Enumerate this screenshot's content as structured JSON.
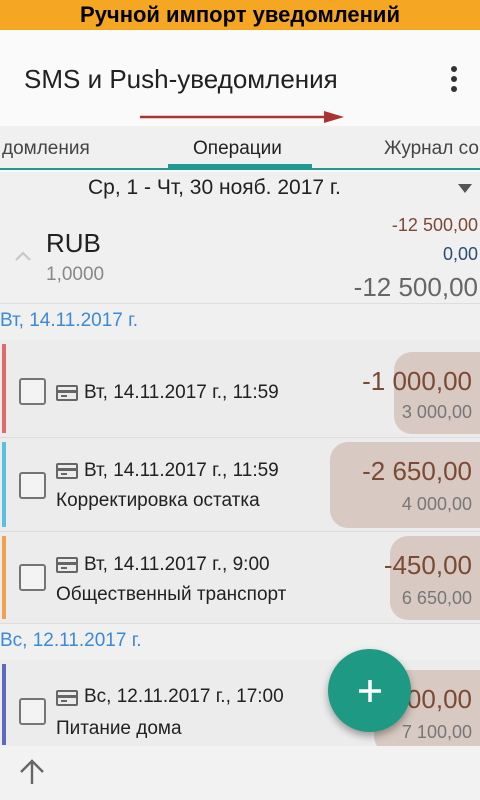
{
  "banner": {
    "text": "Ручной импорт уведомлений"
  },
  "appbar": {
    "title": "SMS и Push-уведомления",
    "menu_icon": "more-vert-icon"
  },
  "tabs": [
    {
      "label": "домления"
    },
    {
      "label": "Операции",
      "active": true
    },
    {
      "label": "Журнал со"
    }
  ],
  "period": {
    "label": "Ср, 1 - Чт, 30 нояб. 2017 г."
  },
  "summary": {
    "currency": "RUB",
    "rate": "1,0000",
    "expense": "-12 500,00",
    "income": "0,00",
    "total": "-12 500,00"
  },
  "groups": [
    {
      "date": "Вт, 14.11.2017 г.",
      "items": [
        {
          "datetime": "Вт, 14.11.2017 г., 11:59",
          "category": "",
          "amount": "-1 000,00",
          "balance": "3 000,00",
          "color": "#e06a6a"
        },
        {
          "datetime": "Вт, 14.11.2017 г., 11:59",
          "category": "Корректировка остатка",
          "amount": "-2 650,00",
          "balance": "4 000,00",
          "color": "#5bbfe0"
        },
        {
          "datetime": "Вт, 14.11.2017 г., 9:00",
          "category": "Общественный транспорт",
          "amount": "-450,00",
          "balance": "6 650,00",
          "color": "#f0a050"
        }
      ]
    },
    {
      "date": "Вс, 12.11.2017 г.",
      "items": [
        {
          "datetime": "Вс, 12.11.2017 г., 17:00",
          "category": "Питание дома",
          "amount": "-700,00",
          "balance": "7 100,00",
          "color": "#5c6bc0"
        }
      ]
    }
  ],
  "colors": {
    "accent": "#1e9a91",
    "fab": "#1e9a84",
    "expense": "#7b4a35",
    "banner": "#f5a623"
  }
}
